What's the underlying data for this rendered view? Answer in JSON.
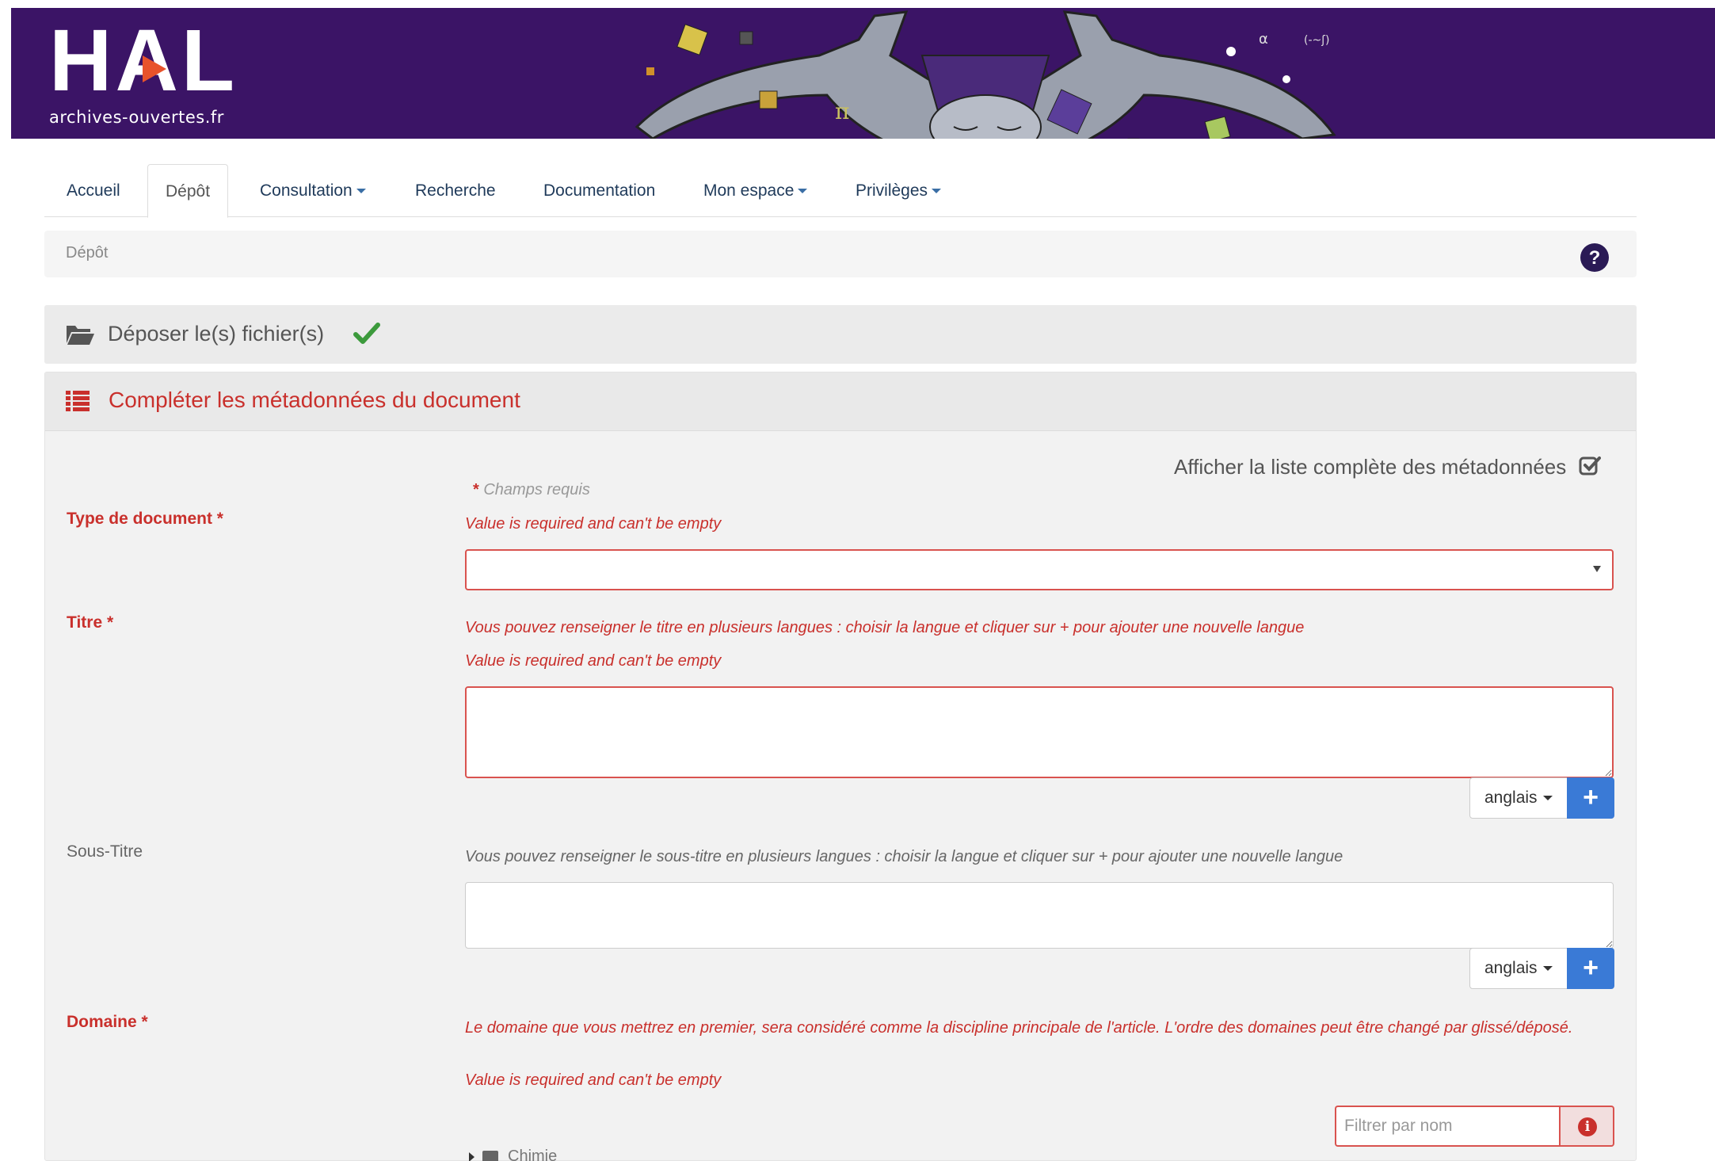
{
  "logo": {
    "name": "HAL",
    "subtitle": "archives-ouvertes.fr"
  },
  "nav": {
    "tabs": [
      {
        "label": "Accueil",
        "active": false,
        "dropdown": false
      },
      {
        "label": "Dépôt",
        "active": true,
        "dropdown": false
      },
      {
        "label": "Consultation",
        "active": false,
        "dropdown": true
      },
      {
        "label": "Recherche",
        "active": false,
        "dropdown": false
      },
      {
        "label": "Documentation",
        "active": false,
        "dropdown": false
      },
      {
        "label": "Mon espace",
        "active": false,
        "dropdown": true
      },
      {
        "label": "Privilèges",
        "active": false,
        "dropdown": true
      }
    ]
  },
  "breadcrumb": {
    "current": "Dépôt"
  },
  "steps": {
    "upload": {
      "title": "Déposer le(s) fichier(s)",
      "done": true
    },
    "metadata": {
      "title": "Compléter les métadonnées du document"
    }
  },
  "form": {
    "show_all_label": "Afficher la liste complète des métadonnées",
    "required_note": "Champs requis",
    "required_star": "*",
    "doc_type": {
      "label": "Type de document *",
      "error": "Value is required and can't be empty",
      "value": ""
    },
    "title": {
      "label": "Titre *",
      "help": "Vous pouvez renseigner le titre en plusieurs langues : choisir la langue et cliquer sur + pour ajouter une nouvelle langue",
      "error": "Value is required and can't be empty",
      "value": "",
      "language": "anglais",
      "add_label": "+"
    },
    "subtitle": {
      "label": "Sous-Titre",
      "help": "Vous pouvez renseigner le sous-titre en plusieurs langues : choisir la langue et cliquer sur + pour ajouter une nouvelle langue",
      "value": "",
      "language": "anglais",
      "add_label": "+"
    },
    "domain": {
      "label": "Domaine *",
      "help": "Le domaine que vous mettrez en premier, sera considéré comme la discipline principale de l'article. L'ordre des domaines peut être changé par glissé/déposé.",
      "error": "Value is required and can't be empty",
      "filter_placeholder": "Filtrer par nom",
      "info_label": "i",
      "tree": [
        "Chimie"
      ]
    }
  },
  "colors": {
    "banner": "#3b1466",
    "error": "#c9302c",
    "primary": "#3a7ad6",
    "success": "#3c9a3c"
  }
}
